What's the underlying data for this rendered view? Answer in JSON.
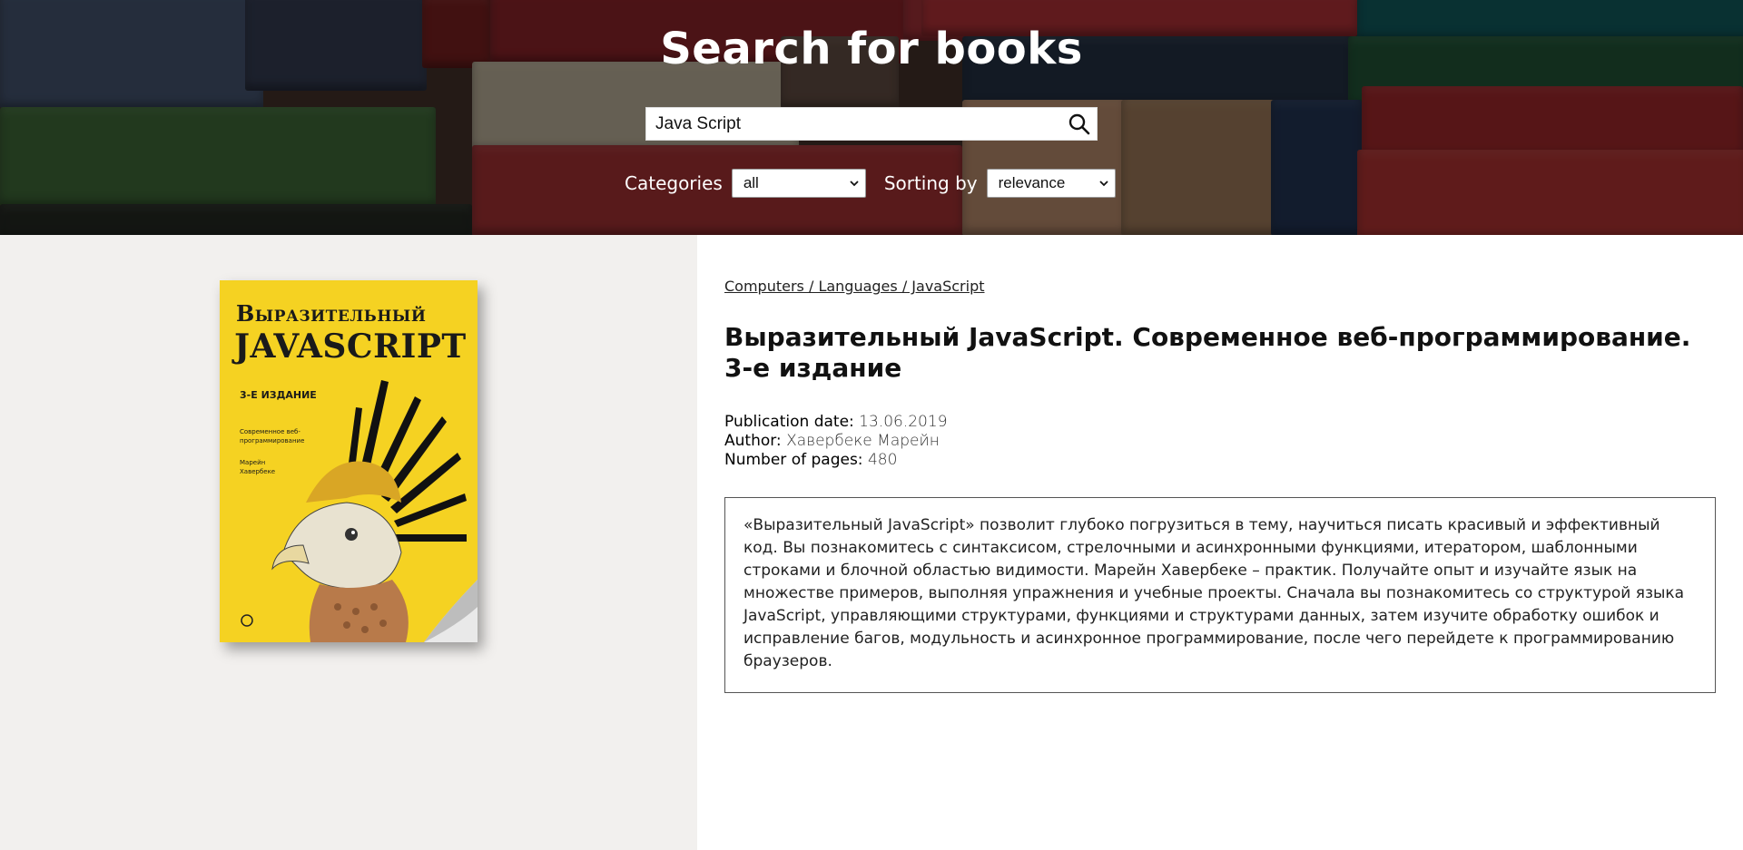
{
  "header": {
    "title": "Search for books",
    "search": {
      "value": "Java Script",
      "icon": "search-icon"
    },
    "filters": {
      "categories_label": "Categories",
      "categories_selected": "all",
      "sorting_label": "Sorting by",
      "sorting_selected": "relevance"
    }
  },
  "book": {
    "cover": {
      "line1": "Выразительный",
      "line2": "JavaScript",
      "edition": "3-е издание",
      "subtitle": "Современное веб-программирование",
      "author": "Марейн Хавербеке",
      "colors": {
        "background": "#f5d222"
      }
    },
    "breadcrumb": "Computers / Languages / JavaScript",
    "title": "Выразительный JavaScript. Современное веб-программирование. 3-е издание",
    "meta": {
      "publication_date_label": "Publication date:",
      "publication_date": "13.06.2019",
      "author_label": "Author:",
      "author": "Хавербеке Марейн",
      "pages_label": "Number of pages:",
      "pages": "480"
    },
    "description": "«Выразительный JavaScript» позволит глубоко погрузиться в тему, научиться писать красивый и эффективный код. Вы познакомитесь с синтаксисом, стрелочными и асинхронными функциями, итератором, шаблонными строками и блочной областью видимости. Марейн Хавербеке – практик. Получайте опыт и изучайте язык на множестве примеров, выполняя упражнения и учебные проекты. Сначала вы познакомитесь со структурой языка JavaScript, управляющими структурами, функциями и структурами данных, затем изучите обработку ошибок и исправление багов, модульность и асинхронное программирование, после чего перейдете к программированию браузеров."
  }
}
